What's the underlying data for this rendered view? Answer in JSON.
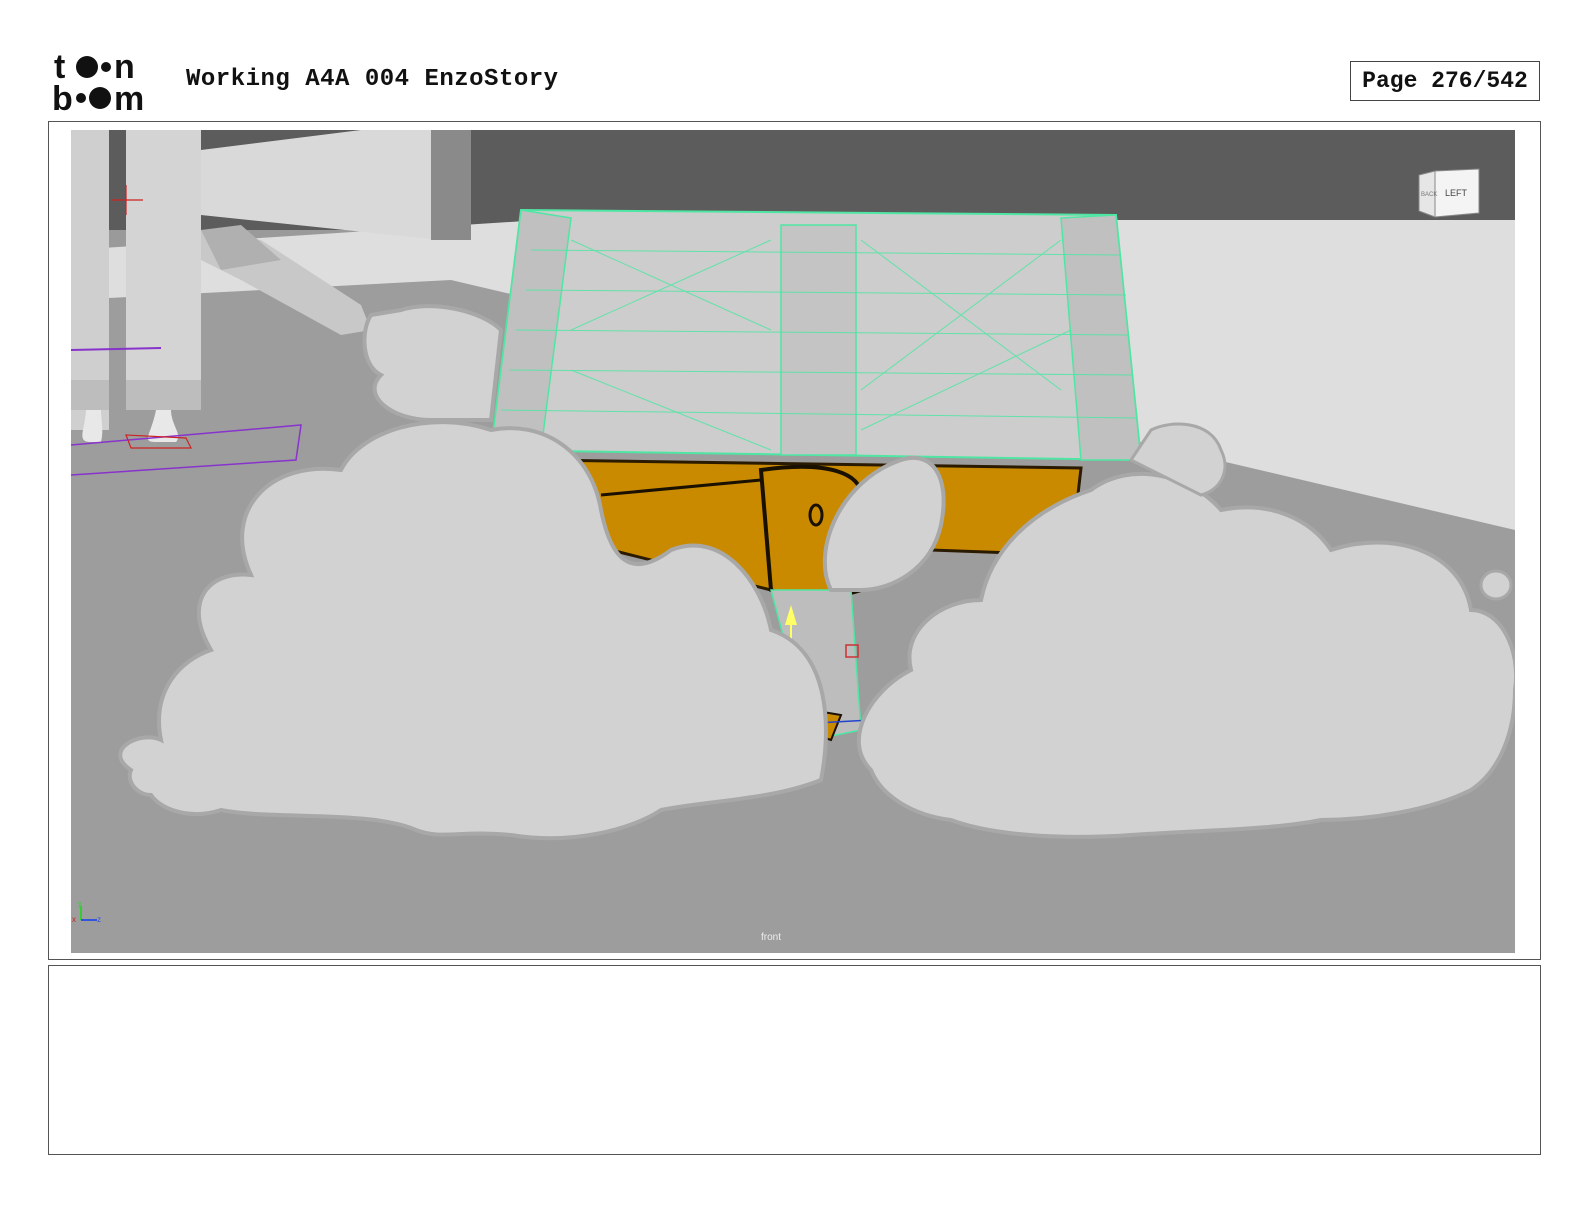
{
  "header": {
    "logo_text": "toon boom",
    "document_title": "Working A4A 004 EnzoStory",
    "page_label": "Page 276/542"
  },
  "viewport": {
    "viewcube_faces": [
      "BACK",
      "LEFT"
    ],
    "camera_label": "front",
    "axis_labels": [
      "x",
      "y",
      "z"
    ]
  },
  "notes": {
    "text": ""
  }
}
